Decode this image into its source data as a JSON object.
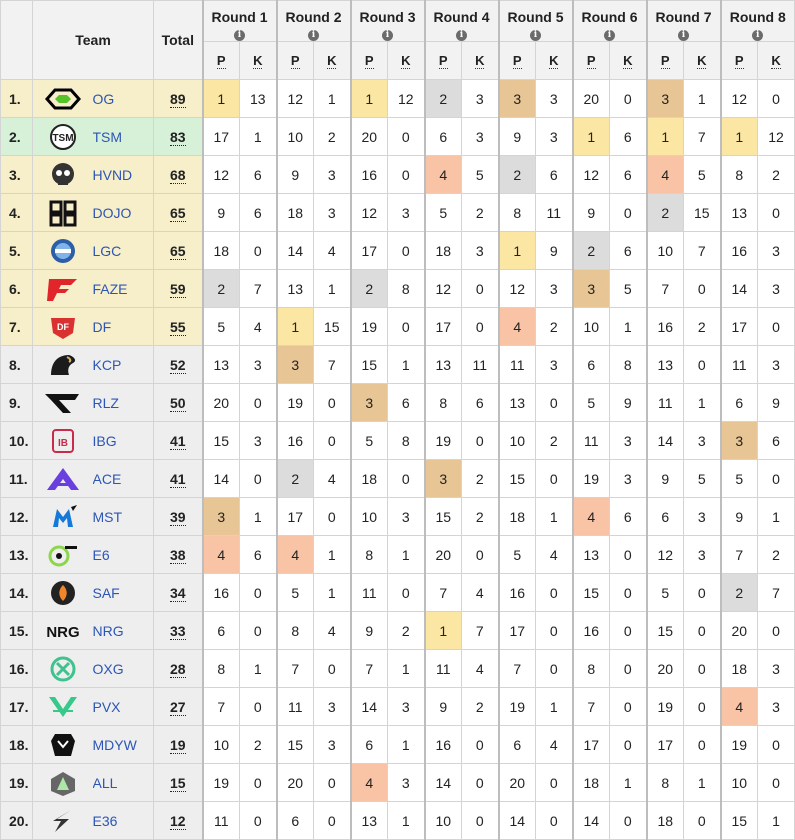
{
  "header": {
    "team": "Team",
    "total": "Total",
    "p_label": "P",
    "k_label": "K",
    "info_glyph": "i",
    "rounds": [
      "Round 1",
      "Round 2",
      "Round 3",
      "Round 4",
      "Round 5",
      "Round 6",
      "Round 7",
      "Round 8"
    ]
  },
  "placement_colors": {
    "first": "#fbe7a3",
    "second": "#dcdcdc",
    "third": "#e8c594",
    "fourth": "#f9c3a6"
  },
  "teams": [
    {
      "rank": "1.",
      "name": "OG",
      "total": "89",
      "band": "gold",
      "logo": "og-logo",
      "rounds": [
        [
          "1",
          "13"
        ],
        [
          "12",
          "1"
        ],
        [
          "1",
          "12"
        ],
        [
          "2",
          "3"
        ],
        [
          "3",
          "3"
        ],
        [
          "20",
          "0"
        ],
        [
          "3",
          "1"
        ],
        [
          "12",
          "0"
        ]
      ]
    },
    {
      "rank": "2.",
      "name": "TSM",
      "total": "83",
      "band": "green",
      "logo": "tsm-logo",
      "rounds": [
        [
          "17",
          "1"
        ],
        [
          "10",
          "2"
        ],
        [
          "20",
          "0"
        ],
        [
          "6",
          "3"
        ],
        [
          "9",
          "3"
        ],
        [
          "1",
          "6"
        ],
        [
          "1",
          "7"
        ],
        [
          "1",
          "12"
        ]
      ]
    },
    {
      "rank": "3.",
      "name": "HVND",
      "total": "68",
      "band": "gold",
      "logo": "hvnd-logo",
      "rounds": [
        [
          "12",
          "6"
        ],
        [
          "9",
          "3"
        ],
        [
          "16",
          "0"
        ],
        [
          "4",
          "5"
        ],
        [
          "2",
          "6"
        ],
        [
          "12",
          "6"
        ],
        [
          "4",
          "5"
        ],
        [
          "8",
          "2"
        ]
      ]
    },
    {
      "rank": "4.",
      "name": "DOJO",
      "total": "65",
      "band": "gold",
      "logo": "dojo-logo",
      "rounds": [
        [
          "9",
          "6"
        ],
        [
          "18",
          "3"
        ],
        [
          "12",
          "3"
        ],
        [
          "5",
          "2"
        ],
        [
          "8",
          "11"
        ],
        [
          "9",
          "0"
        ],
        [
          "2",
          "15"
        ],
        [
          "13",
          "0"
        ]
      ]
    },
    {
      "rank": "5.",
      "name": "LGC",
      "total": "65",
      "band": "gold",
      "logo": "lgc-logo",
      "rounds": [
        [
          "18",
          "0"
        ],
        [
          "14",
          "4"
        ],
        [
          "17",
          "0"
        ],
        [
          "18",
          "3"
        ],
        [
          "1",
          "9"
        ],
        [
          "2",
          "6"
        ],
        [
          "10",
          "7"
        ],
        [
          "16",
          "3"
        ]
      ]
    },
    {
      "rank": "6.",
      "name": "FAZE",
      "total": "59",
      "band": "gold",
      "logo": "faze-logo",
      "rounds": [
        [
          "2",
          "7"
        ],
        [
          "13",
          "1"
        ],
        [
          "2",
          "8"
        ],
        [
          "12",
          "0"
        ],
        [
          "12",
          "3"
        ],
        [
          "3",
          "5"
        ],
        [
          "7",
          "0"
        ],
        [
          "14",
          "3"
        ]
      ]
    },
    {
      "rank": "7.",
      "name": "DF",
      "total": "55",
      "band": "gold",
      "logo": "df-logo",
      "rounds": [
        [
          "5",
          "4"
        ],
        [
          "1",
          "15"
        ],
        [
          "19",
          "0"
        ],
        [
          "17",
          "0"
        ],
        [
          "4",
          "2"
        ],
        [
          "10",
          "1"
        ],
        [
          "16",
          "2"
        ],
        [
          "17",
          "0"
        ]
      ]
    },
    {
      "rank": "8.",
      "name": "KCP",
      "total": "52",
      "band": "gray",
      "logo": "kcp-logo",
      "rounds": [
        [
          "13",
          "3"
        ],
        [
          "3",
          "7"
        ],
        [
          "15",
          "1"
        ],
        [
          "13",
          "11"
        ],
        [
          "11",
          "3"
        ],
        [
          "6",
          "8"
        ],
        [
          "13",
          "0"
        ],
        [
          "11",
          "3"
        ]
      ]
    },
    {
      "rank": "9.",
      "name": "RLZ",
      "total": "50",
      "band": "gray",
      "logo": "rlz-logo",
      "rounds": [
        [
          "20",
          "0"
        ],
        [
          "19",
          "0"
        ],
        [
          "3",
          "6"
        ],
        [
          "8",
          "6"
        ],
        [
          "13",
          "0"
        ],
        [
          "5",
          "9"
        ],
        [
          "11",
          "1"
        ],
        [
          "6",
          "9"
        ]
      ]
    },
    {
      "rank": "10.",
      "name": "IBG",
      "total": "41",
      "band": "gray",
      "logo": "ibg-logo",
      "rounds": [
        [
          "15",
          "3"
        ],
        [
          "16",
          "0"
        ],
        [
          "5",
          "8"
        ],
        [
          "19",
          "0"
        ],
        [
          "10",
          "2"
        ],
        [
          "11",
          "3"
        ],
        [
          "14",
          "3"
        ],
        [
          "3",
          "6"
        ]
      ]
    },
    {
      "rank": "11.",
      "name": "ACE",
      "total": "41",
      "band": "gray",
      "logo": "ace-logo",
      "rounds": [
        [
          "14",
          "0"
        ],
        [
          "2",
          "4"
        ],
        [
          "18",
          "0"
        ],
        [
          "3",
          "2"
        ],
        [
          "15",
          "0"
        ],
        [
          "19",
          "3"
        ],
        [
          "9",
          "5"
        ],
        [
          "5",
          "0"
        ]
      ]
    },
    {
      "rank": "12.",
      "name": "MST",
      "total": "39",
      "band": "gray",
      "logo": "mst-logo",
      "rounds": [
        [
          "3",
          "1"
        ],
        [
          "17",
          "0"
        ],
        [
          "10",
          "3"
        ],
        [
          "15",
          "2"
        ],
        [
          "18",
          "1"
        ],
        [
          "4",
          "6"
        ],
        [
          "6",
          "3"
        ],
        [
          "9",
          "1"
        ]
      ]
    },
    {
      "rank": "13.",
      "name": "E6",
      "total": "38",
      "band": "gray",
      "logo": "e6-logo",
      "rounds": [
        [
          "4",
          "6"
        ],
        [
          "4",
          "1"
        ],
        [
          "8",
          "1"
        ],
        [
          "20",
          "0"
        ],
        [
          "5",
          "4"
        ],
        [
          "13",
          "0"
        ],
        [
          "12",
          "3"
        ],
        [
          "7",
          "2"
        ]
      ]
    },
    {
      "rank": "14.",
      "name": "SAF",
      "total": "34",
      "band": "gray",
      "logo": "saf-logo",
      "rounds": [
        [
          "16",
          "0"
        ],
        [
          "5",
          "1"
        ],
        [
          "11",
          "0"
        ],
        [
          "7",
          "4"
        ],
        [
          "16",
          "0"
        ],
        [
          "15",
          "0"
        ],
        [
          "5",
          "0"
        ],
        [
          "2",
          "7"
        ]
      ]
    },
    {
      "rank": "15.",
      "name": "NRG",
      "total": "33",
      "band": "gray",
      "logo": "nrg-logo",
      "rounds": [
        [
          "6",
          "0"
        ],
        [
          "8",
          "4"
        ],
        [
          "9",
          "2"
        ],
        [
          "1",
          "7"
        ],
        [
          "17",
          "0"
        ],
        [
          "16",
          "0"
        ],
        [
          "15",
          "0"
        ],
        [
          "20",
          "0"
        ]
      ]
    },
    {
      "rank": "16.",
      "name": "OXG",
      "total": "28",
      "band": "gray",
      "logo": "oxg-logo",
      "rounds": [
        [
          "8",
          "1"
        ],
        [
          "7",
          "0"
        ],
        [
          "7",
          "1"
        ],
        [
          "11",
          "4"
        ],
        [
          "7",
          "0"
        ],
        [
          "8",
          "0"
        ],
        [
          "20",
          "0"
        ],
        [
          "18",
          "3"
        ]
      ]
    },
    {
      "rank": "17.",
      "name": "PVX",
      "total": "27",
      "band": "gray",
      "logo": "pvx-logo",
      "rounds": [
        [
          "7",
          "0"
        ],
        [
          "11",
          "3"
        ],
        [
          "14",
          "3"
        ],
        [
          "9",
          "2"
        ],
        [
          "19",
          "1"
        ],
        [
          "7",
          "0"
        ],
        [
          "19",
          "0"
        ],
        [
          "4",
          "3"
        ]
      ]
    },
    {
      "rank": "18.",
      "name": "MDYW",
      "total": "19",
      "band": "gray",
      "logo": "mdyw-logo",
      "rounds": [
        [
          "10",
          "2"
        ],
        [
          "15",
          "3"
        ],
        [
          "6",
          "1"
        ],
        [
          "16",
          "0"
        ],
        [
          "6",
          "4"
        ],
        [
          "17",
          "0"
        ],
        [
          "17",
          "0"
        ],
        [
          "19",
          "0"
        ]
      ]
    },
    {
      "rank": "19.",
      "name": "ALL",
      "total": "15",
      "band": "gray",
      "logo": "all-logo",
      "rounds": [
        [
          "19",
          "0"
        ],
        [
          "20",
          "0"
        ],
        [
          "4",
          "3"
        ],
        [
          "14",
          "0"
        ],
        [
          "20",
          "0"
        ],
        [
          "18",
          "1"
        ],
        [
          "8",
          "1"
        ],
        [
          "10",
          "0"
        ]
      ]
    },
    {
      "rank": "20.",
      "name": "E36",
      "total": "12",
      "band": "gray",
      "logo": "e36-logo",
      "rounds": [
        [
          "11",
          "0"
        ],
        [
          "6",
          "0"
        ],
        [
          "13",
          "1"
        ],
        [
          "10",
          "0"
        ],
        [
          "14",
          "0"
        ],
        [
          "14",
          "0"
        ],
        [
          "18",
          "0"
        ],
        [
          "15",
          "1"
        ]
      ]
    }
  ]
}
